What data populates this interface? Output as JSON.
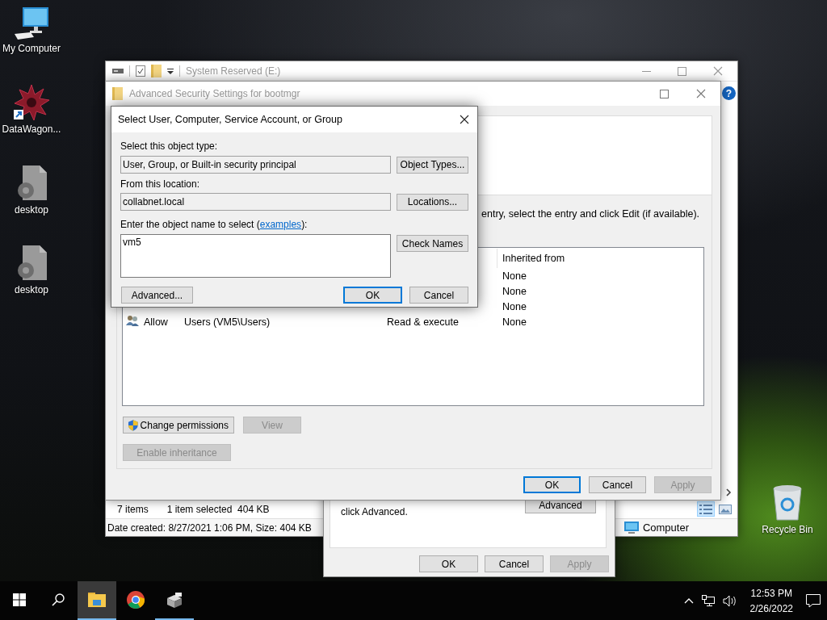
{
  "desktop_icons": [
    {
      "kind": "computer",
      "label": "My Computer"
    },
    {
      "kind": "shortcut",
      "label": "DataWagon..."
    },
    {
      "kind": "file",
      "label": "desktop"
    },
    {
      "kind": "file",
      "label": "desktop"
    },
    {
      "kind": "recycle",
      "label": "Recycle Bin"
    }
  ],
  "explorer": {
    "title": "System Reserved (E:)",
    "help": "?",
    "item_count": "7 items",
    "selection": "1 item selected  404 KB",
    "views": [
      {
        "kind": "details",
        "selected": true
      },
      {
        "kind": "preview",
        "selected": false
      }
    ],
    "details": "Date created: 8/27/2021 1:06 PM, Size: 404 KB",
    "location": "Computer"
  },
  "properties": {
    "note": "click Advanced.",
    "advanced_button": {
      "label": "Advanced",
      "disabled": false
    },
    "buttons": [
      {
        "label": "OK",
        "disabled": false
      },
      {
        "label": "Cancel",
        "disabled": false
      },
      {
        "label": "Apply",
        "disabled": true
      }
    ]
  },
  "advanced_security": {
    "title": "Advanced Security Settings for bootmgr",
    "instruction": "entry, select the entry and click Edit (if available).",
    "table": {
      "columns": [
        "Inherited from"
      ],
      "rows": [
        {
          "inherited_from": "None"
        },
        {
          "inherited_from": "None"
        },
        {
          "inherited_from": "None"
        },
        {
          "type": "Allow",
          "principal": "Users (VM5\\Users)",
          "access": "Read & execute",
          "inherited_from": "None"
        }
      ]
    },
    "actions": [
      {
        "label": "Change permissions",
        "shield": true,
        "disabled": false
      },
      {
        "label": "View",
        "shield": false,
        "disabled": true
      }
    ],
    "inheritance_button": {
      "label": "Enable inheritance",
      "disabled": true
    },
    "buttons": [
      {
        "label": "OK",
        "default": true,
        "disabled": false
      },
      {
        "label": "Cancel",
        "default": false,
        "disabled": false
      },
      {
        "label": "Apply",
        "default": false,
        "disabled": true
      }
    ]
  },
  "select_dialog": {
    "title": "Select User, Computer, Service Account, or Group",
    "object_type_label": "Select this object type:",
    "object_type": "User, Group, or Built-in security principal",
    "object_types_button": "Object Types...",
    "location_label": "From this location:",
    "location": "collabnet.local",
    "locations_button": "Locations...",
    "name_label": {
      "before": "Enter the object name to select (",
      "link": "examples",
      "after": "):"
    },
    "object_name": "vm5",
    "check_names_button": "Check Names",
    "advanced_button": "Advanced...",
    "buttons": [
      {
        "label": "OK",
        "default": true
      },
      {
        "label": "Cancel",
        "default": false
      }
    ]
  },
  "taskbar": {
    "apps": [
      {
        "kind": "explorer",
        "active": true,
        "running": true
      },
      {
        "kind": "chrome",
        "active": false,
        "running": false
      },
      {
        "kind": "app",
        "active": false,
        "running": true
      }
    ],
    "time": "12:53 PM",
    "date": "2/26/2022"
  }
}
